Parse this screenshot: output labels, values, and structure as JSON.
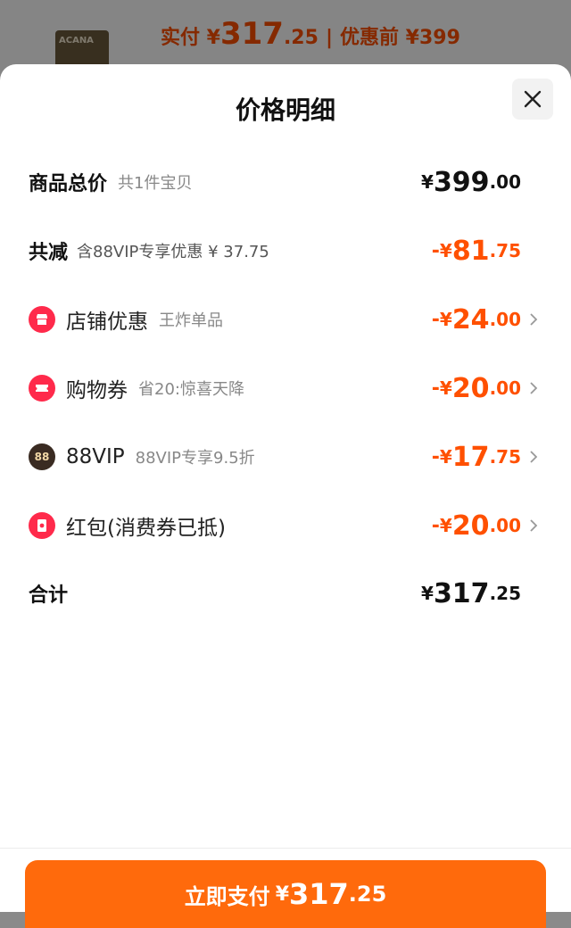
{
  "background": {
    "product_thumb_text": "ACANA",
    "paid_label": "实付 ¥",
    "paid_int": "317",
    "paid_dec": ".25",
    "sep": "|",
    "before_label": "优惠前 ¥399"
  },
  "sheet": {
    "title": "价格明细"
  },
  "total_goods": {
    "label": "商品总价",
    "sub": "共1件宝贝",
    "yen": "¥",
    "int": "399",
    "dec": ".00"
  },
  "total_reduce": {
    "label": "共减",
    "sub": "含88VIP专享优惠 ¥ 37.75",
    "minus": "-",
    "yen": "¥",
    "int": "81",
    "dec": ".75"
  },
  "items": [
    {
      "label": "店铺优惠",
      "sub": "王炸单品",
      "minus": "-",
      "yen": "¥",
      "int": "24",
      "dec": ".00",
      "icon": "shop-icon"
    },
    {
      "label": "购物券",
      "sub": "省20:惊喜天降",
      "minus": "-",
      "yen": "¥",
      "int": "20",
      "dec": ".00",
      "icon": "coupon-icon"
    },
    {
      "label": "88VIP",
      "sub": "88VIP专享9.5折",
      "minus": "-",
      "yen": "¥",
      "int": "17",
      "dec": ".75",
      "icon": "vip-icon",
      "icon_text": "88"
    },
    {
      "label": "红包(消费券已抵)",
      "sub": "",
      "minus": "-",
      "yen": "¥",
      "int": "20",
      "dec": ".00",
      "icon": "red-packet-icon"
    }
  ],
  "sum": {
    "label": "合计",
    "yen": "¥",
    "int": "317",
    "dec": ".25"
  },
  "pay_button": {
    "label": "立即支付",
    "yen": "¥",
    "int": "317",
    "dec": ".25"
  },
  "colors": {
    "accent": "#ff5000",
    "button": "#ff6a0c",
    "icon_red": "#ff2a4b",
    "icon_dark": "#3a2b22"
  }
}
